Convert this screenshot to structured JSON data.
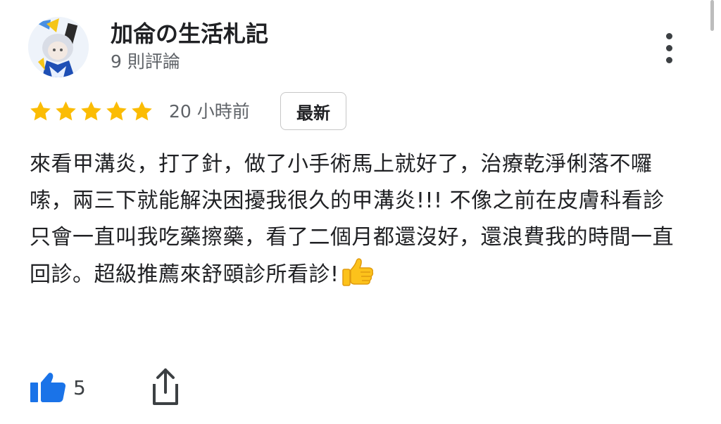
{
  "reviewer": {
    "name": "加侖の生活札記",
    "review_count": "9 則評論"
  },
  "review": {
    "rating": 5,
    "time": "20 小時前",
    "badge": "最新",
    "text": "來看甲溝炎，打了針，做了小手術馬上就好了，治療乾淨俐落不囉嗦，兩三下就能解決困擾我很久的甲溝炎!!! 不像之前在皮膚科看診只會一直叫我吃藥擦藥，看了二個月都還沒好，還浪費我的時間一直回診。超級推薦來舒頤診所看診!",
    "emoji": "thumbs-up"
  },
  "actions": {
    "like_count": "5",
    "like_icon": "thumbs-up-icon",
    "share_icon": "share-icon",
    "more_icon": "more-vert-icon"
  },
  "colors": {
    "star": "#fbbc04",
    "like_icon": "#1a73e8",
    "text": "#202124",
    "secondary": "#5f6368"
  }
}
